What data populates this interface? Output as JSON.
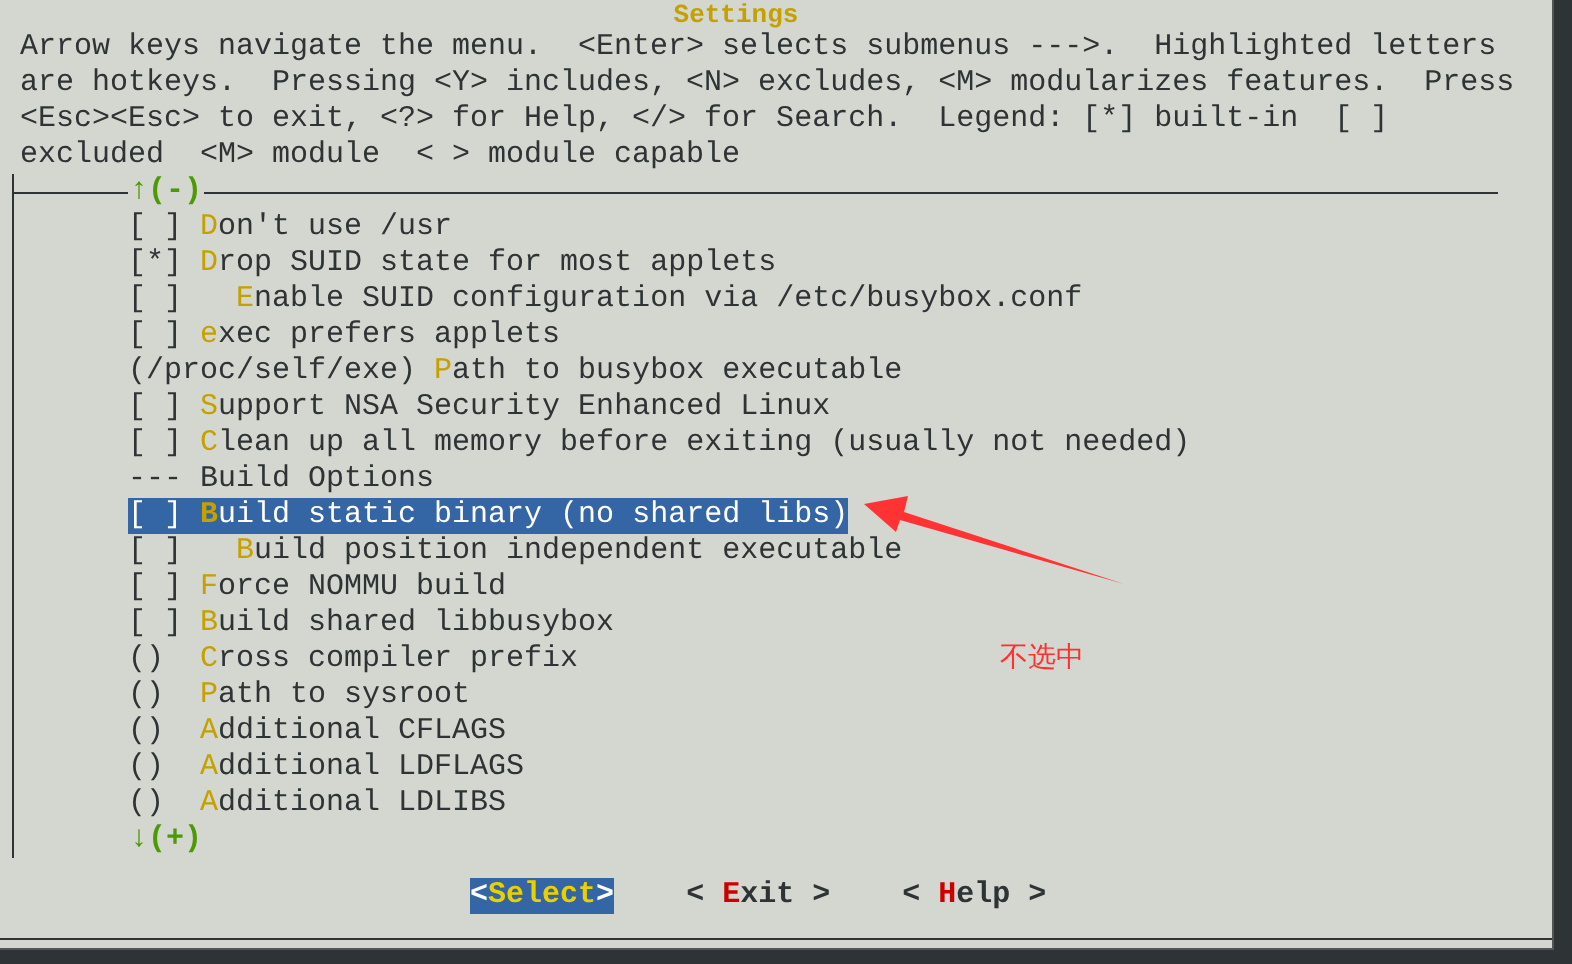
{
  "dialog": {
    "title": "Settings",
    "help_text": [
      "Arrow keys navigate the menu.  <Enter> selects submenus --->.  Highlighted letters",
      "are hotkeys.  Pressing <Y> includes, <N> excludes, <M> modularizes features.  Press",
      "<Esc><Esc> to exit, <?> for Help, </> for Search.  Legend: [*] built-in  [ ]",
      "excluded  <M> module  < > module capable"
    ],
    "scroll_up": "↑(-)",
    "items": [
      {
        "kind": "option",
        "marker": "[ ]",
        "text": "Don't use /usr",
        "selected": false
      },
      {
        "kind": "option",
        "marker": "[*]",
        "text": "Drop SUID state for most applets",
        "selected": false,
        "children": [
          {
            "kind": "option",
            "marker": "[ ]",
            "text": "Enable SUID configuration via /etc/busybox.conf",
            "selected": false
          }
        ]
      },
      {
        "kind": "option",
        "marker": "[ ]",
        "text": "exec prefers applets",
        "selected": false
      },
      {
        "kind": "option",
        "marker": "(/proc/self/exe)",
        "text": "Path to busybox executable",
        "selected": false
      },
      {
        "kind": "option",
        "marker": "[ ]",
        "text": "Support NSA Security Enhanced Linux",
        "selected": false
      },
      {
        "kind": "option",
        "marker": "[ ]",
        "text": "Clean up all memory before exiting (usually not needed)",
        "selected": false
      },
      {
        "kind": "comment",
        "marker": "---",
        "text": "Build Options",
        "selected": false
      },
      {
        "kind": "option",
        "marker": "[ ]",
        "text": "Build static binary (no shared libs)",
        "selected": true,
        "children": [
          {
            "kind": "option",
            "marker": "[ ]",
            "text": "Build position independent executable",
            "selected": false
          }
        ]
      },
      {
        "kind": "option",
        "marker": "[ ]",
        "text": "Force NOMMU build",
        "selected": false
      },
      {
        "kind": "option",
        "marker": "[ ]",
        "text": "Build shared libbusybox",
        "selected": false
      },
      {
        "kind": "option",
        "marker": "()",
        "text": "Cross compiler prefix",
        "selected": false
      },
      {
        "kind": "option",
        "marker": "()",
        "text": "Path to sysroot",
        "selected": false
      },
      {
        "kind": "option",
        "marker": "()",
        "text": "Additional CFLAGS",
        "selected": false
      },
      {
        "kind": "option",
        "marker": "()",
        "text": "Additional LDFLAGS",
        "selected": false
      },
      {
        "kind": "option",
        "marker": "()",
        "text": "Additional LDLIBS",
        "selected": false
      }
    ],
    "scroll_down": "↓(+)",
    "buttons": [
      {
        "label": "<Select>",
        "selected": true
      },
      {
        "label": "< Exit >",
        "selected": false
      },
      {
        "label": "< Help >",
        "selected": false
      }
    ]
  },
  "annotation": {
    "text": "不选中"
  }
}
